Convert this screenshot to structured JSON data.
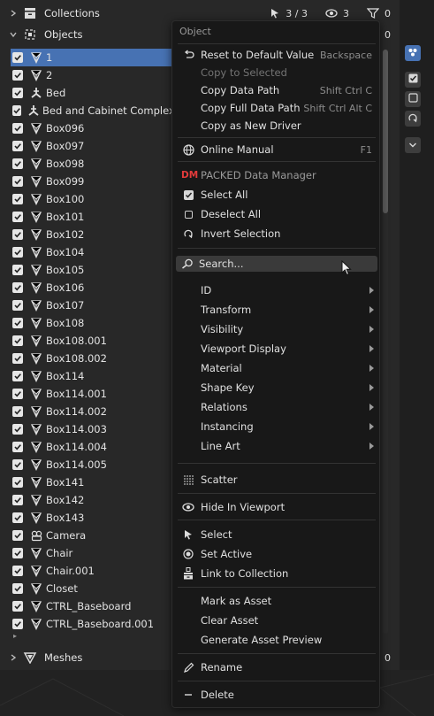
{
  "outliner": {
    "collections_label": "Collections",
    "collections_count": "3 / 3",
    "collections_vis": "3",
    "collections_filter": "0",
    "objects_label": "Objects",
    "objects_filter": "0",
    "meshes_label": "Meshes",
    "meshes_count": "0",
    "items": [
      {
        "label": "1",
        "icon": "empty-axis-icon"
      },
      {
        "label": "2",
        "icon": "empty-axis-icon"
      },
      {
        "label": "Bed",
        "icon": "armature-icon"
      },
      {
        "label": "Bed and Cabinet Complex",
        "icon": "armature-icon"
      },
      {
        "label": "Box096",
        "icon": "empty-axis-icon"
      },
      {
        "label": "Box097",
        "icon": "empty-axis-icon"
      },
      {
        "label": "Box098",
        "icon": "empty-axis-icon"
      },
      {
        "label": "Box099",
        "icon": "empty-axis-icon"
      },
      {
        "label": "Box100",
        "icon": "empty-axis-icon"
      },
      {
        "label": "Box101",
        "icon": "empty-axis-icon"
      },
      {
        "label": "Box102",
        "icon": "empty-axis-icon"
      },
      {
        "label": "Box104",
        "icon": "empty-axis-icon"
      },
      {
        "label": "Box105",
        "icon": "empty-axis-icon"
      },
      {
        "label": "Box106",
        "icon": "empty-axis-icon"
      },
      {
        "label": "Box107",
        "icon": "empty-axis-icon"
      },
      {
        "label": "Box108",
        "icon": "empty-axis-icon"
      },
      {
        "label": "Box108.001",
        "icon": "empty-axis-icon"
      },
      {
        "label": "Box108.002",
        "icon": "empty-axis-icon"
      },
      {
        "label": "Box114",
        "icon": "empty-axis-icon"
      },
      {
        "label": "Box114.001",
        "icon": "empty-axis-icon"
      },
      {
        "label": "Box114.002",
        "icon": "empty-axis-icon"
      },
      {
        "label": "Box114.003",
        "icon": "empty-axis-icon"
      },
      {
        "label": "Box114.004",
        "icon": "empty-axis-icon"
      },
      {
        "label": "Box114.005",
        "icon": "empty-axis-icon"
      },
      {
        "label": "Box141",
        "icon": "empty-axis-icon"
      },
      {
        "label": "Box142",
        "icon": "empty-axis-icon"
      },
      {
        "label": "Box143",
        "icon": "empty-axis-icon"
      },
      {
        "label": "Camera",
        "icon": "camera-icon"
      },
      {
        "label": "Chair",
        "icon": "empty-axis-icon"
      },
      {
        "label": "Chair.001",
        "icon": "empty-axis-icon"
      },
      {
        "label": "Closet",
        "icon": "empty-axis-icon"
      },
      {
        "label": "CTRL_Baseboard",
        "icon": "empty-axis-icon"
      },
      {
        "label": "CTRL_Baseboard.001",
        "icon": "empty-axis-icon"
      }
    ]
  },
  "menu": {
    "title": "Object",
    "reset_default": "Reset to Default Value",
    "reset_default_sc": "Backspace",
    "copy_selected": "Copy to Selected",
    "copy_data_path": "Copy Data Path",
    "copy_data_path_sc": "Shift Ctrl C",
    "copy_full_data_path": "Copy Full Data Path",
    "copy_full_data_path_sc": "Shift Ctrl Alt C",
    "copy_as_driver": "Copy as New Driver",
    "online_manual": "Online Manual",
    "online_manual_sc": "F1",
    "dm_badge": "DM",
    "packed_dm": "PACKED Data Manager",
    "select_all": "Select All",
    "deselect_all": "Deselect All",
    "invert_selection": "Invert Selection",
    "search": "Search...",
    "submenus": [
      "ID",
      "Transform",
      "Visibility",
      "Viewport Display",
      "Material",
      "Shape Key",
      "Relations",
      "Instancing",
      "Line Art"
    ],
    "scatter": "Scatter",
    "hide_viewport": "Hide In Viewport",
    "select": "Select",
    "set_active": "Set Active",
    "link_collection": "Link to Collection",
    "mark_asset": "Mark as Asset",
    "clear_asset": "Clear Asset",
    "generate_preview": "Generate Asset Preview",
    "rename": "Rename",
    "delete": "Delete"
  },
  "colors": {
    "selection": "#4772b3",
    "menu_bg": "#181818",
    "panel_bg": "#282828",
    "dm_red": "#e23b3b"
  }
}
